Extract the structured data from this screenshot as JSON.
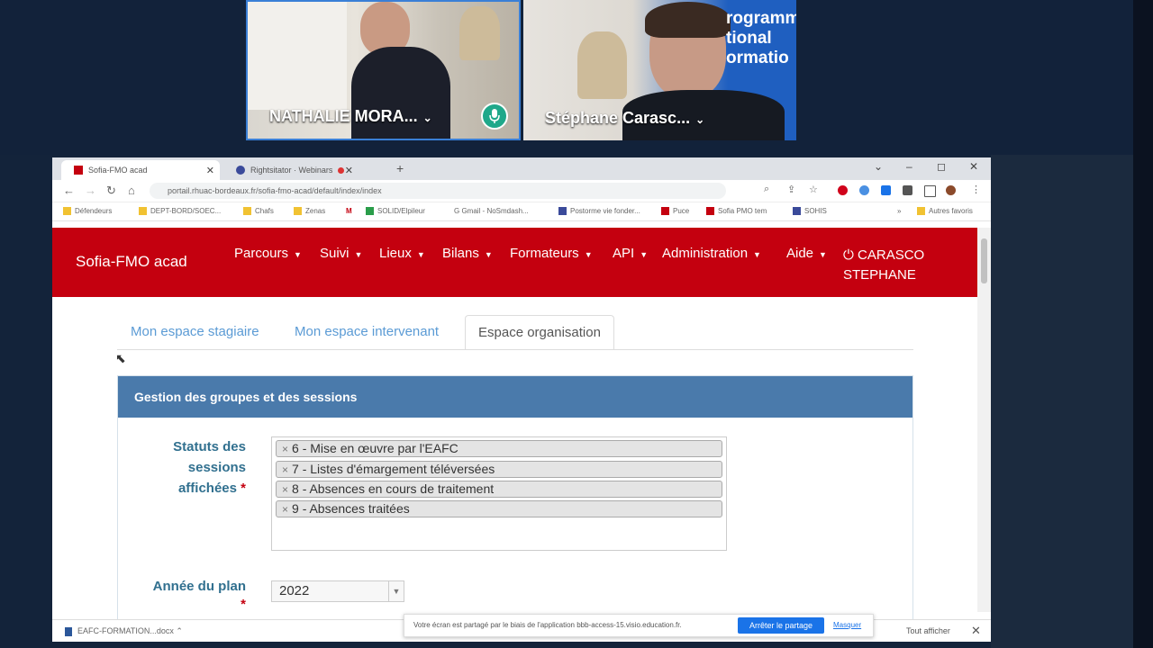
{
  "video_call": {
    "participants": [
      {
        "name": "NATHALIE MORA...",
        "chevron": "⌄",
        "mic_icon": "microphone-icon"
      },
      {
        "name": "Stéphane Carasc...",
        "chevron": "⌄"
      }
    ],
    "background_sign": [
      "rogramm",
      "tional",
      "ormatio"
    ]
  },
  "browser": {
    "tabs": [
      {
        "label": "Sofia-FMO acad",
        "active": true
      },
      {
        "label": "Rightsitator · Webinars",
        "active": false
      }
    ],
    "new_tab": "+",
    "window_controls": [
      "⌄",
      "–",
      "◻",
      "✕"
    ],
    "url": "portail.rhuac-bordeaux.fr/sofia-fmo-acad/default/index/index",
    "bookmarks": [
      "Défendeurs",
      "DEPT-BORD/SOEC...",
      "Chafs",
      "Zenas",
      "M",
      "SOLID/Elpileur",
      "G Gmail - NoSmdash...",
      "Postorme vie fonder...",
      "Puce",
      "Sofia PMO tem",
      "SOHIS",
      "»",
      "Autres favoris"
    ]
  },
  "app": {
    "brand": "Sofia-FMO acad",
    "menu": [
      "Parcours",
      "Suivi",
      "Lieux",
      "Bilans",
      "Formateurs",
      "API",
      "Administration",
      "Aide"
    ],
    "user": {
      "line1": "CARASCO",
      "line2": "STEPHANE",
      "icon": "power-icon"
    }
  },
  "page": {
    "tabs": [
      {
        "label": "Mon espace stagiaire",
        "active": false
      },
      {
        "label": "Mon espace intervenant",
        "active": false
      },
      {
        "label": "Espace organisation",
        "active": true
      }
    ],
    "panel_title": "Gestion des groupes et des sessions",
    "statuts": {
      "label_lines": [
        "Statuts des",
        "sessions",
        "affichées"
      ],
      "required": "*",
      "selected": [
        "6 - Mise en œuvre par l'EAFC",
        "7 - Listes d'émargement téléversées",
        "8 - Absences en cours de traitement",
        "9 - Absences traitées"
      ],
      "remove_glyph": "×"
    },
    "annee": {
      "label": "Année du plan",
      "required": "*",
      "value": "2022"
    }
  },
  "bottom_bar": {
    "download": "EAFC-FORMATION...docx",
    "share_message": "Votre écran est partagé par le biais de l'application bbb-access-15.visio.education.fr.",
    "share_button": "Arrêter le partage",
    "hide_link": "Masquer",
    "show_all": "Tout afficher",
    "close": "✕"
  }
}
